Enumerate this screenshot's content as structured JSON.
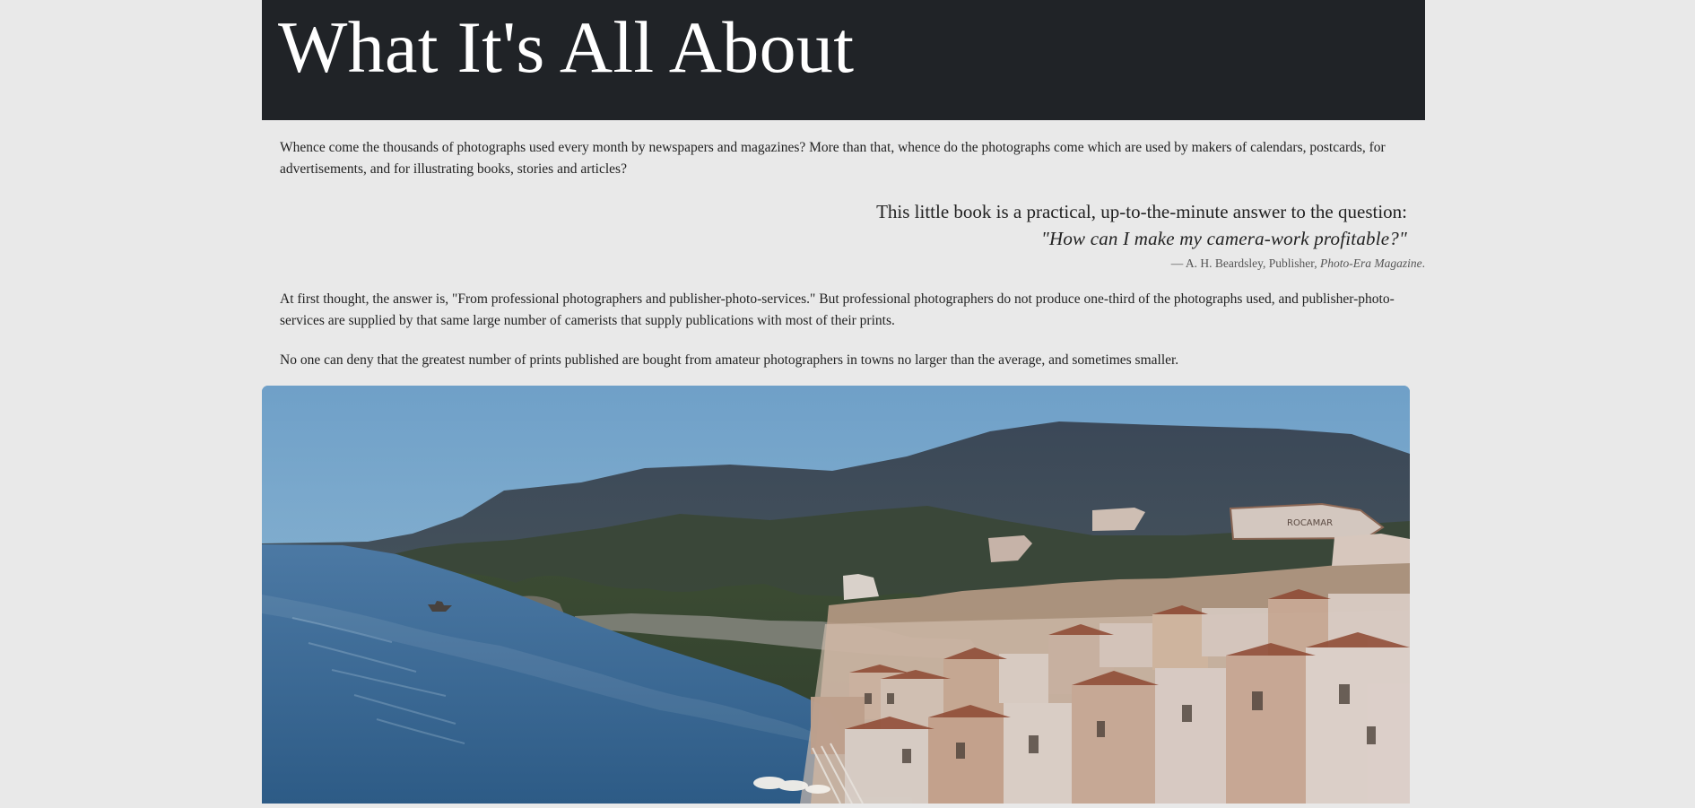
{
  "header": {
    "title": "What It's All About"
  },
  "intro": {
    "paragraph": "Whence come the thousands of photographs used every month by newspapers and magazines? More than that, whence do the photographs come which are used by makers of calendars, postcards, for advertisements, and for illustrating books, stories and articles?"
  },
  "quote": {
    "line1": "This little book is a practical, up-to-the-minute answer to the question:",
    "line2": "\"How can I make my camera-work profitable?\"",
    "attribution_prefix": "— A. H. Beardsley, Publisher,",
    "magazine": "Photo-Era Magazine",
    "attribution_suffix": "."
  },
  "body": {
    "paragraph1": "At first thought, the answer is, \"From professional photographers and publisher-photo-services.\" But professional photographers do not produce one-third of the photographs used, and publisher-photo-services are supplied by that same large number of camerists that supply publications with most of their prints.",
    "paragraph2": "No one can deny that the greatest number of prints published are bought from amateur photographers in towns no larger than the average, and sometimes smaller."
  },
  "hero": {
    "alt": "Coastal village overlooking a blue bay and hills",
    "sign": "ROCAMAR"
  },
  "colors": {
    "background": "#e9e9e9",
    "masthead": "#202327",
    "text": "#222222",
    "muted": "#555555"
  }
}
